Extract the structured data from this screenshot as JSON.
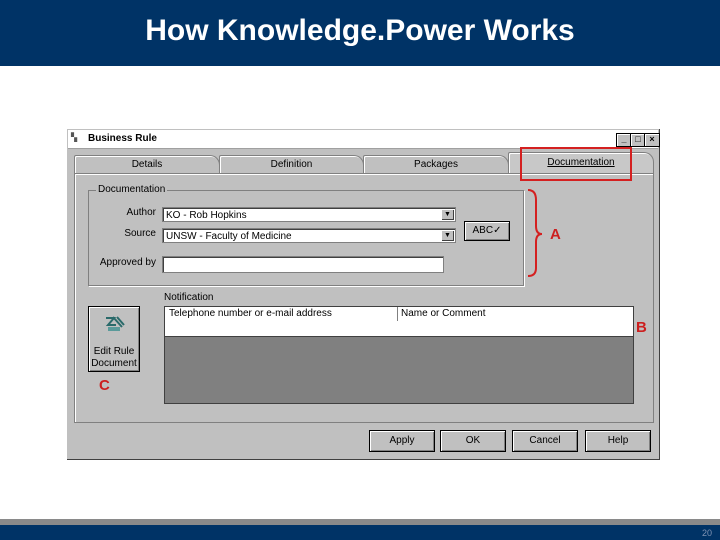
{
  "slide": {
    "title": "How Knowledge.Power Works",
    "page_number": "20"
  },
  "window": {
    "title": "Business Rule",
    "controls": [
      "_",
      "□",
      "×"
    ]
  },
  "tabs": [
    {
      "label": "Details"
    },
    {
      "label": "Definition"
    },
    {
      "label": "Packages"
    },
    {
      "label": "Documentation",
      "active": true
    }
  ],
  "documentation_group": {
    "label": "Documentation",
    "author_label": "Author",
    "author_value": "KO - Rob Hopkins",
    "source_label": "Source",
    "source_value": "UNSW - Faculty of Medicine",
    "approved_label": "Approved by",
    "approved_value": "",
    "spell_button": "ABC✓"
  },
  "notification": {
    "label": "Notification",
    "columns": [
      "Telephone number or e-mail address",
      "Name or Comment"
    ]
  },
  "edit_rule_button": {
    "line1": "Edit Rule",
    "line2": "Document"
  },
  "buttons": {
    "apply": "Apply",
    "ok": "OK",
    "cancel": "Cancel",
    "help": "Help"
  },
  "annotations": {
    "a": "A",
    "b": "B",
    "c": "C"
  },
  "colors": {
    "header": "#003366",
    "highlight": "#d42020",
    "window_face": "#c0c0c0"
  }
}
